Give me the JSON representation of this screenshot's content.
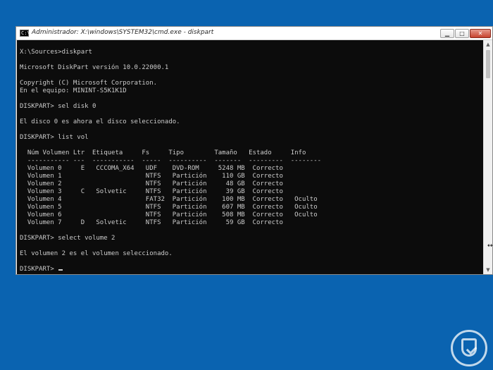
{
  "window": {
    "title": "Administrador: X:\\windows\\SYSTEM32\\cmd.exe - diskpart",
    "icon_label": "C:\\",
    "controls": {
      "minimize": "▁",
      "maximize": "□",
      "close": "✕"
    }
  },
  "console": {
    "lines": [
      "X:\\Sources>diskpart",
      "",
      "Microsoft DiskPart versión 10.0.22000.1",
      "",
      "Copyright (C) Microsoft Corporation.",
      "En el equipo: MININT-S5K1K1D",
      "",
      "DISKPART> sel disk 0",
      "",
      "El disco 0 es ahora el disco seleccionado.",
      "",
      "DISKPART> list vol",
      "",
      "  Núm Volumen Ltr  Etiqueta     Fs     Tipo        Tamaño   Estado     Info",
      "  ----------- ---  -----------  -----  ----------  -------  ---------  --------",
      "  Volumen 0     E   CCCOMA_X64   UDF    DVD-ROM     5248 MB  Correcto",
      "  Volumen 1                      NTFS   Partición    110 GB  Correcto",
      "  Volumen 2                      NTFS   Partición     48 GB  Correcto",
      "  Volumen 3     C   Solvetic     NTFS   Partición     39 GB  Correcto",
      "  Volumen 4                      FAT32  Partición    100 MB  Correcto   Oculto",
      "  Volumen 5                      NTFS   Partición    607 MB  Correcto   Oculto",
      "  Volumen 6                      NTFS   Partición    508 MB  Correcto   Oculto",
      "  Volumen 7     D   Solvetic     NTFS   Partición     59 GB  Correcto",
      "",
      "DISKPART> select volume 2",
      "",
      "El volumen 2 es el volumen seleccionado.",
      "",
      "DISKPART> "
    ]
  },
  "scrollbar": {
    "up": "▲",
    "down": "▼"
  },
  "pointer": "↔"
}
